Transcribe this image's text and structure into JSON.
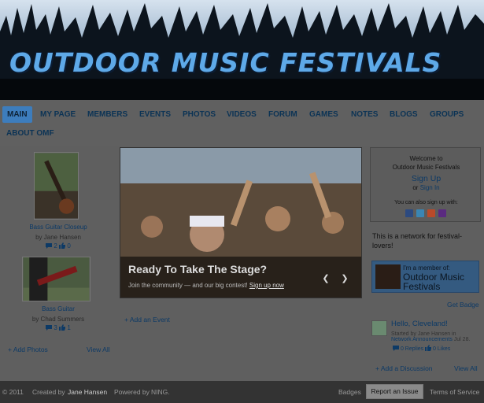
{
  "header": {
    "title": "OUTDOOR MUSIC FESTIVALS"
  },
  "nav": {
    "items": [
      "MAIN",
      "MY PAGE",
      "MEMBERS",
      "EVENTS",
      "PHOTOS",
      "VIDEOS",
      "FORUM",
      "GAMES",
      "NOTES",
      "BLOGS",
      "GROUPS",
      "ABOUT OMF"
    ],
    "active": "MAIN"
  },
  "photos": [
    {
      "title": "Bass Guitar Closeup",
      "by": "by Jane Hansen",
      "comments": "2",
      "likes": "0"
    },
    {
      "title": "Bass Guitar",
      "by": "by Chad Summers",
      "comments": "3",
      "likes": "1"
    }
  ],
  "photos_actions": {
    "add": "+ Add Photos",
    "view_all": "View All"
  },
  "slideshow": {
    "title": "Ready To Take The Stage?",
    "subtitle_text": "Join the community — and our big contest!",
    "subtitle_link": "Sign up now",
    "prev_icon": "chevron-left-icon",
    "next_icon": "chevron-right-icon"
  },
  "events": {
    "add": "+ Add an Event"
  },
  "welcome": {
    "line1": "Welcome to",
    "line2": "Outdoor Music Festivals",
    "signup": "Sign Up",
    "or": "or",
    "signin": "Sign In",
    "also": "You can also sign up with:",
    "social_icons": [
      "facebook-icon",
      "twitter-icon",
      "google-icon",
      "yahoo-icon"
    ],
    "social_colors": [
      "#2c4a80",
      "#3a86b4",
      "#b94a2a",
      "#5a2a80"
    ]
  },
  "network_desc": "This is a network for festival-lovers!",
  "member_badge": {
    "small": "I'm a member of:",
    "big": "Outdoor Music Festivals"
  },
  "get_badge": "Get Badge",
  "discussion": {
    "title": "Hello, Cleveland!",
    "started_by": "Started by Jane Hansen in",
    "category": "Network Announcements",
    "date": "Jul 28.",
    "replies": "0 Replies",
    "likes": "0 Likes",
    "add": "+ Add a Discussion",
    "view_all": "View All"
  },
  "footer": {
    "copyright": "© 2011",
    "created_by_label": "Created by",
    "created_by_name": "Jane Hansen",
    "powered_by": "Powered by",
    "ning": "NING.",
    "badges": "Badges",
    "report": "Report an Issue",
    "terms": "Terms of Service"
  }
}
